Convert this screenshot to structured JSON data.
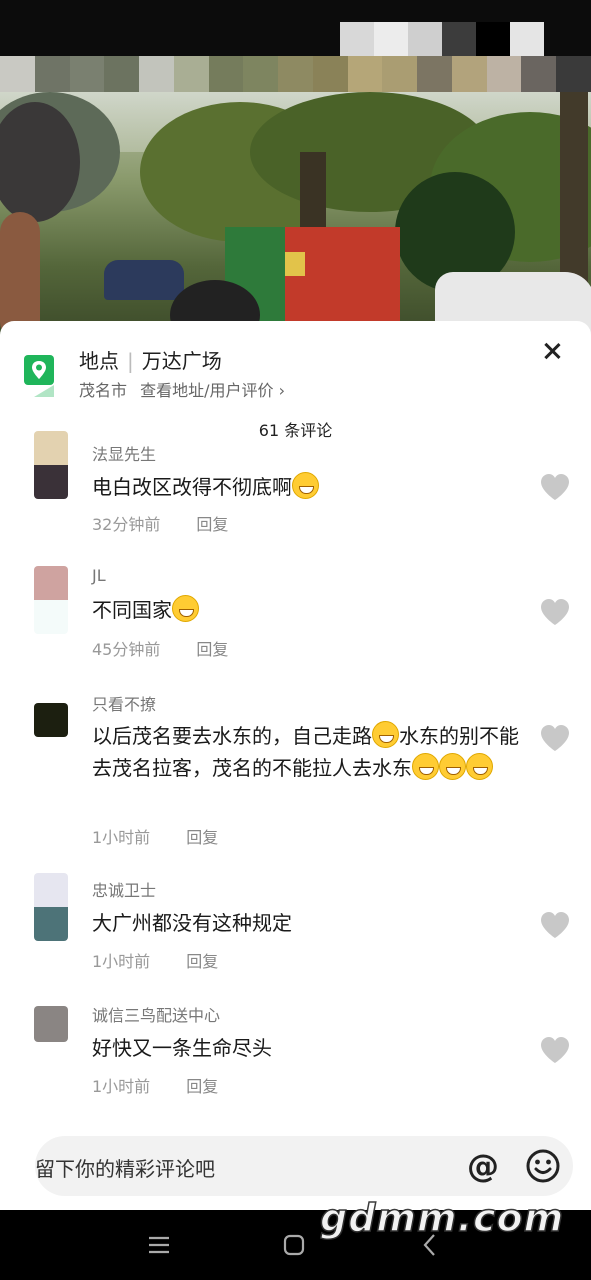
{
  "location": {
    "label": "地点",
    "name": "万达广场",
    "city": "茂名市",
    "link": "查看地址/用户评价 ›"
  },
  "comment_count": "61 条评论",
  "comments": [
    {
      "username": "法显先生",
      "text": "电白改区改得不彻底啊",
      "emojis": 1,
      "time": "32分钟前",
      "reply": "回复"
    },
    {
      "username": "JL",
      "text": "不同国家",
      "emojis": 1,
      "time": "45分钟前",
      "reply": "回复"
    },
    {
      "username": "只看不撩",
      "text": "以后茂名要去水东的，自己走路",
      "text2": "水东的别不能去茂名拉客，茂名的不能拉人去水东",
      "emojis": 3,
      "time": "1小时前",
      "reply": "回复"
    },
    {
      "username": "忠诚卫士",
      "text": "大广州都没有这种规定",
      "emojis": 0,
      "time": "1小时前",
      "reply": "回复"
    },
    {
      "username": "诚信三鸟配送中心",
      "text": "好快又一条生命尽头",
      "emojis": 0,
      "time": "1小时前",
      "reply": "回复"
    }
  ],
  "input": {
    "placeholder": "留下你的精彩评论吧"
  },
  "icons": [
    "location-pin-icon",
    "close-icon",
    "heart-icon",
    "at-icon",
    "smile-icon",
    "menu-icon",
    "home-icon",
    "back-icon"
  ],
  "colors": {
    "location_green": "#1fb55a",
    "like_gray": "#c8c8c8"
  },
  "watermark": "gdmm.com"
}
